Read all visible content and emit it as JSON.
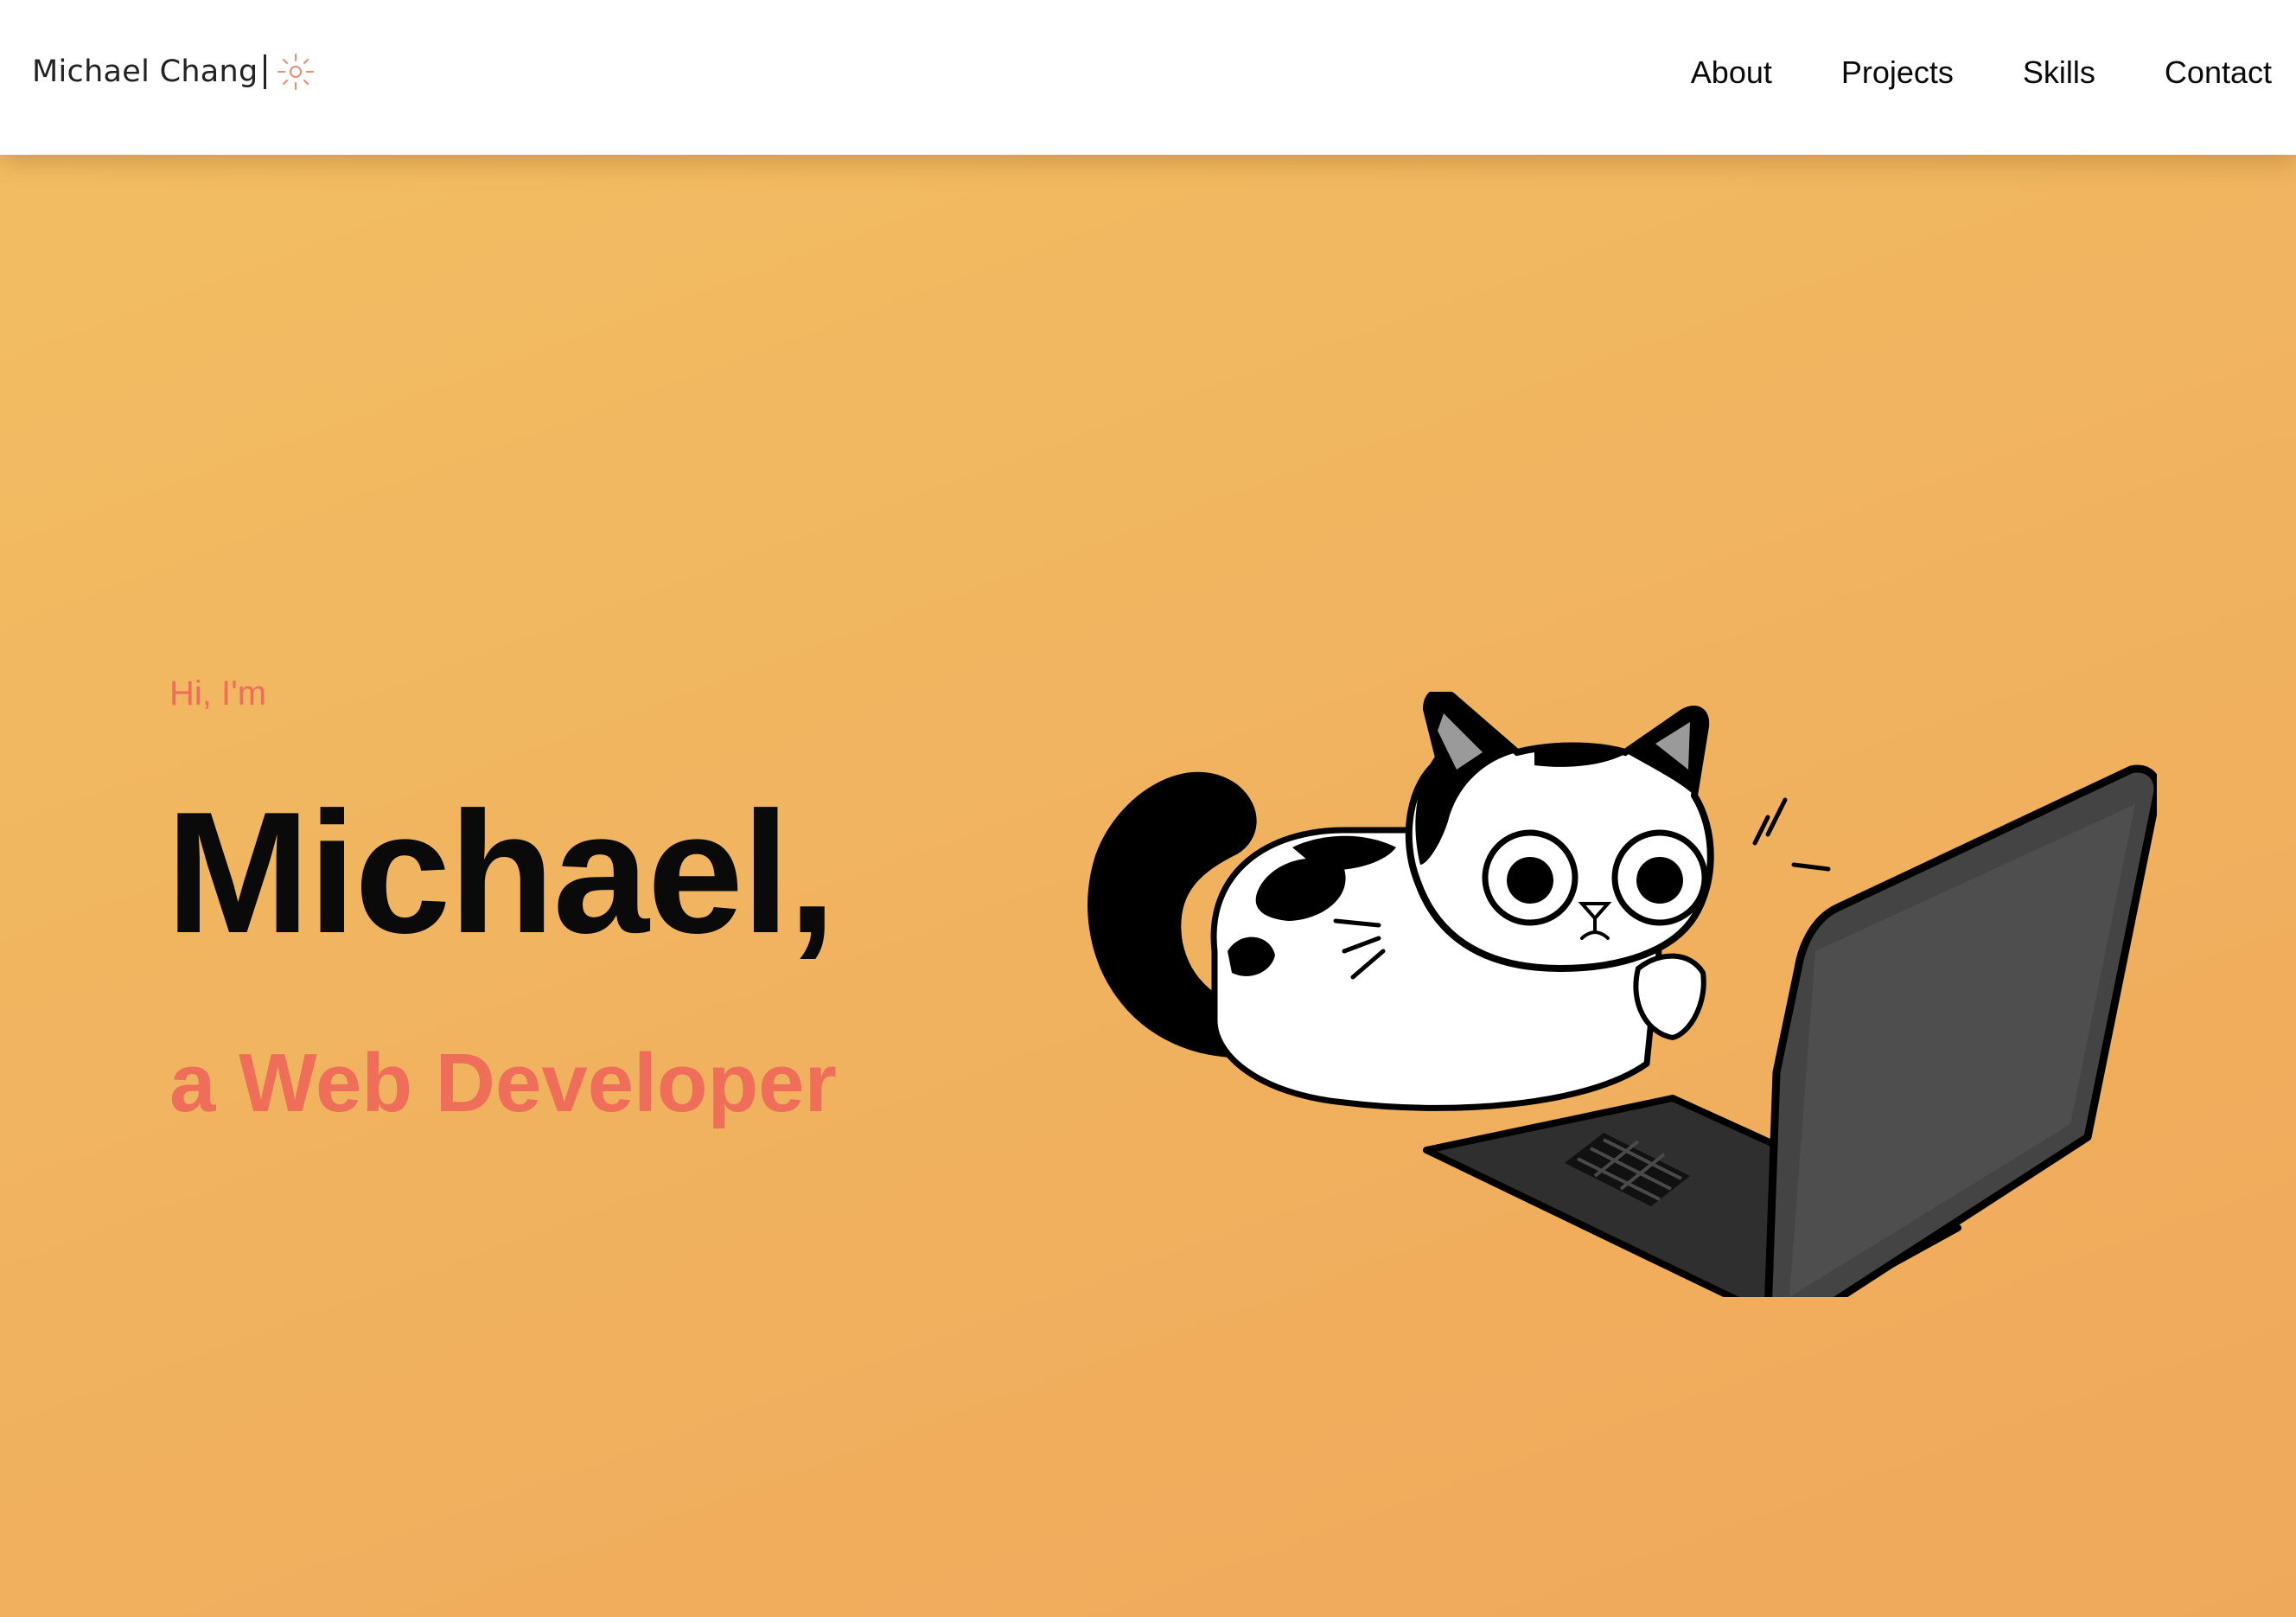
{
  "nav": {
    "brand": "Michael Chang",
    "brand_icon": "sun-icon",
    "links": [
      "About",
      "Projects",
      "Skills",
      "Contact"
    ]
  },
  "hero": {
    "greeting": "Hi, I'm",
    "name": "Michael,",
    "role": "a Web Developer",
    "illustration": "cat-on-laptop-illustration"
  },
  "colors": {
    "accent": "#ee6e5a",
    "background_top": "#f3bf63",
    "background_bottom": "#efa95b",
    "text": "#0a0a0a"
  }
}
